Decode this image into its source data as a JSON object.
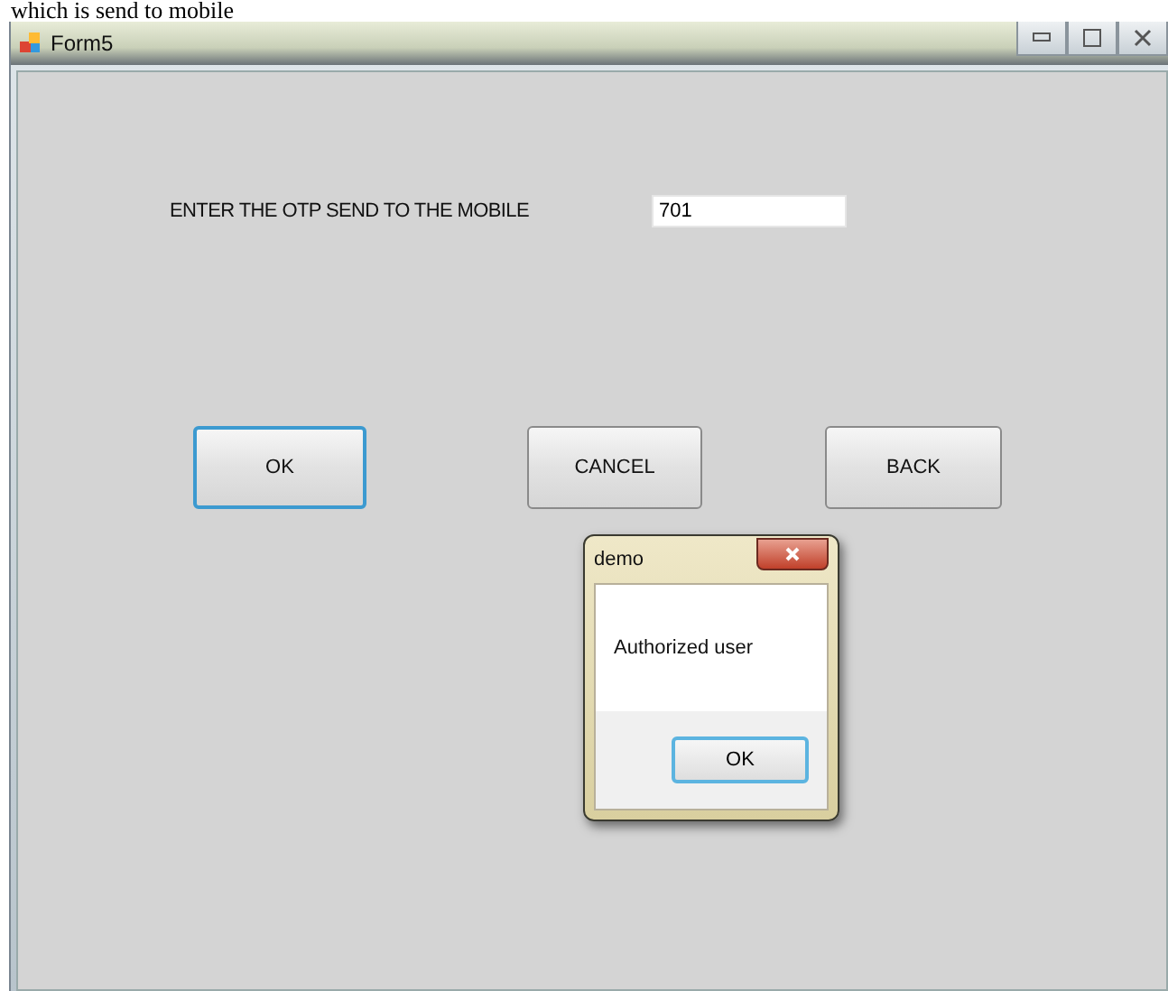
{
  "caption": "which is send to mobile",
  "window": {
    "title": "Form5"
  },
  "form": {
    "label": "ENTER THE OTP SEND TO THE MOBILE",
    "otp_value": "701"
  },
  "buttons": [
    {
      "label": "OK",
      "focused": true
    },
    {
      "label": "CANCEL",
      "focused": false
    },
    {
      "label": "BACK",
      "focused": false
    }
  ],
  "dialog": {
    "title": "demo",
    "message": "Authorized user",
    "button": "OK"
  }
}
